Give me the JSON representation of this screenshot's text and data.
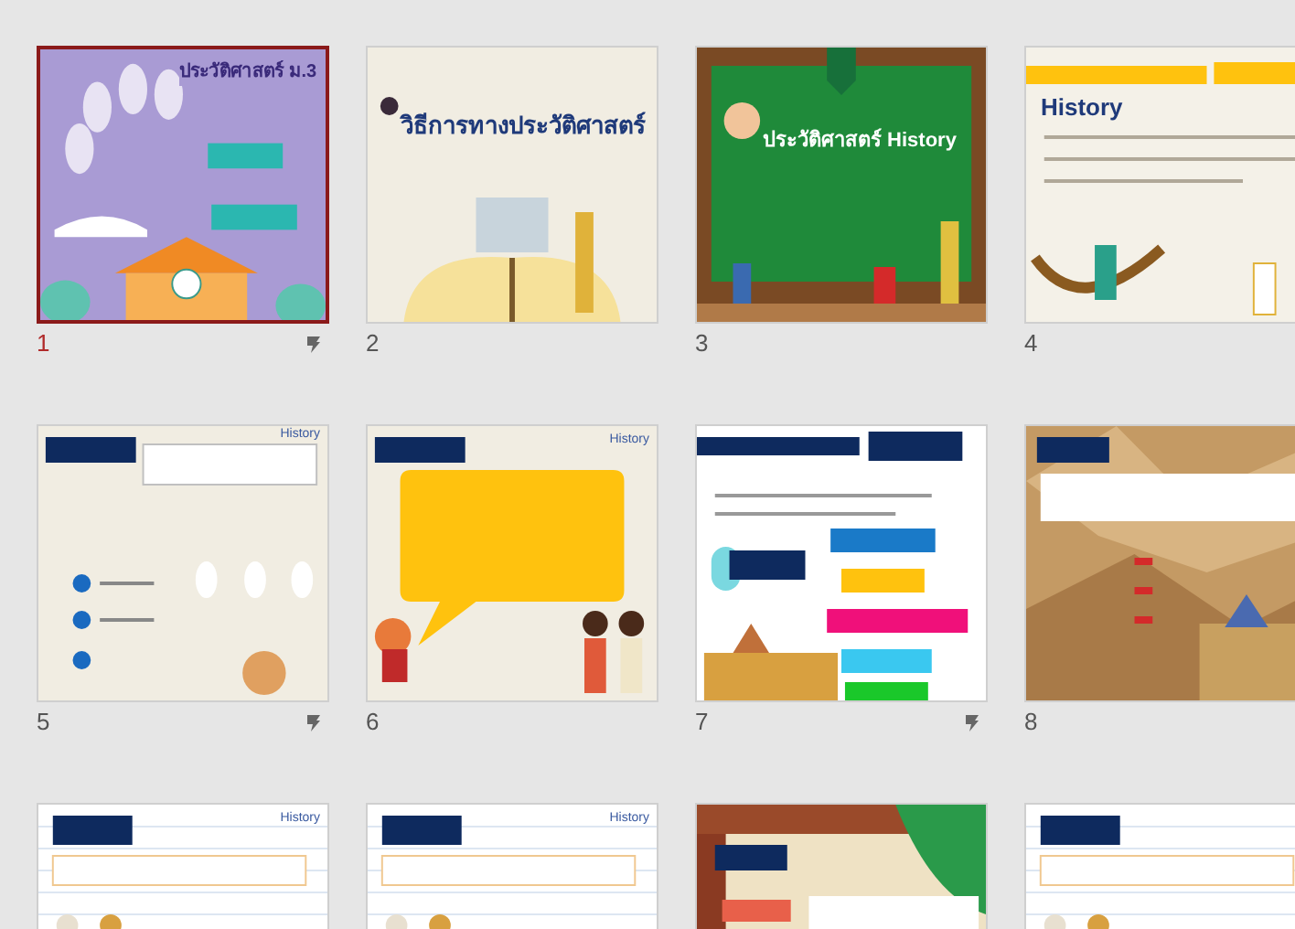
{
  "slides": [
    {
      "number": "1",
      "selected": true,
      "transition": true,
      "kind": "title-purple",
      "title": "ประวัติศาสตร์ ม.3"
    },
    {
      "number": "2",
      "selected": false,
      "transition": false,
      "kind": "title-cream",
      "title": "วิธีการทางประวัติศาสตร์"
    },
    {
      "number": "3",
      "selected": false,
      "transition": false,
      "kind": "chalkboard",
      "title": "ประวัติศาสตร์ History"
    },
    {
      "number": "4",
      "selected": false,
      "transition": false,
      "kind": "yellow-bars",
      "title": "History"
    },
    {
      "number": "5",
      "selected": false,
      "transition": true,
      "kind": "navy-tag",
      "title": "History"
    },
    {
      "number": "6",
      "selected": false,
      "transition": false,
      "kind": "speech-bubble",
      "title": "History"
    },
    {
      "number": "7",
      "selected": false,
      "transition": true,
      "kind": "menu-buttons"
    },
    {
      "number": "8",
      "selected": false,
      "transition": false,
      "kind": "crumpled-paper"
    },
    {
      "selected": false,
      "kind": "lined-white",
      "title": "History"
    },
    {
      "selected": false,
      "kind": "lined-white",
      "title": "History"
    },
    {
      "selected": false,
      "kind": "brick-wall"
    },
    {
      "selected": false,
      "kind": "lined-white"
    }
  ]
}
